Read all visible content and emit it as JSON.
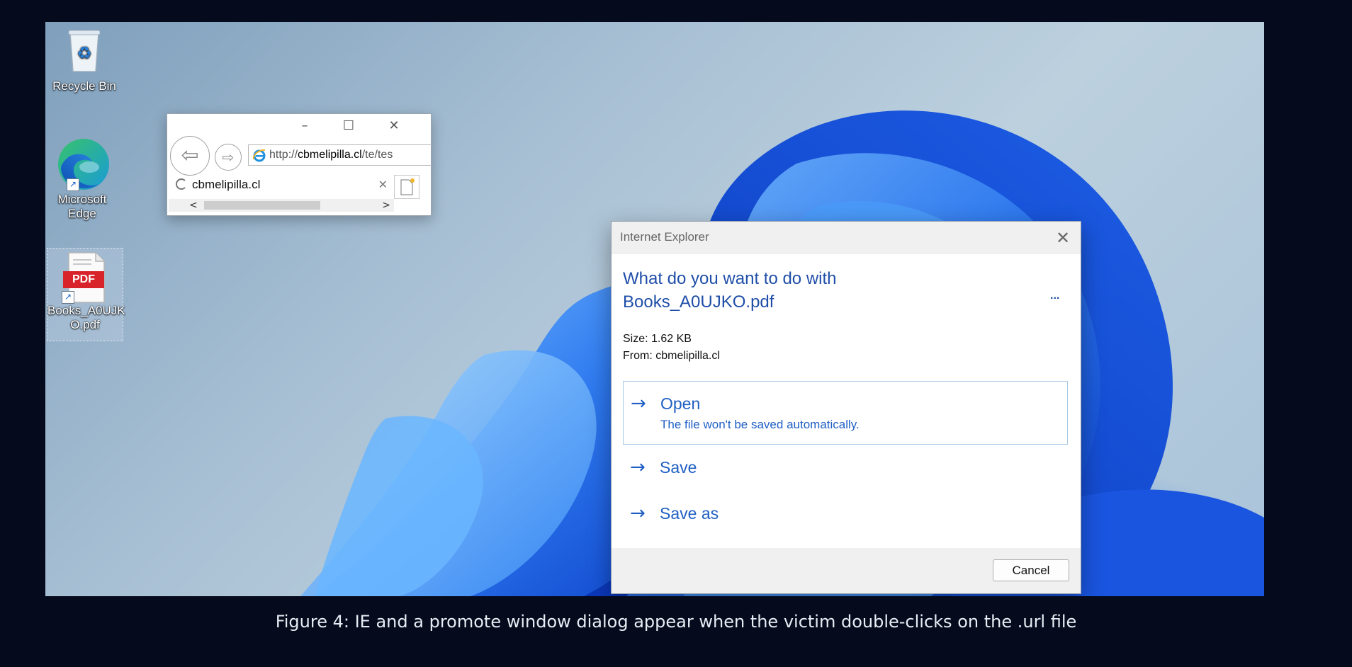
{
  "desktop": {
    "icons": [
      {
        "name": "recycle-bin",
        "label": "Recycle Bin"
      },
      {
        "name": "microsoft-edge",
        "label_lines": [
          "Microsoft",
          "Edge"
        ]
      },
      {
        "name": "pdf-shortcut",
        "label_lines": [
          "Books_A0UJK",
          "O.pdf"
        ],
        "badge": "PDF"
      }
    ]
  },
  "ie_window": {
    "address_prefix": "http://",
    "address_domain": "cbmelipilla.cl",
    "address_suffix": "/te/tes",
    "tab_title": "cbmelipilla.cl",
    "controls": {
      "minimize": "–",
      "maximize": "☐",
      "close": "✕"
    }
  },
  "dialog": {
    "title": "Internet Explorer",
    "question_line1": "What do you want to do with",
    "question_line2": "Books_A0UJKO.pdf",
    "more": "...",
    "size": "Size: 1.62 KB",
    "from": "From: cbmelipilla.cl",
    "options": [
      {
        "label": "Open",
        "description": "The file won't be saved automatically."
      },
      {
        "label": "Save"
      },
      {
        "label": "Save as"
      }
    ],
    "cancel": "Cancel"
  },
  "caption": "Figure 4: IE and a promote window dialog appear when the victim double-clicks on the .url file",
  "colors": {
    "page_bg": "#050a1c",
    "dialog_accent": "#1f4ea8",
    "option_text": "#1f5fc4",
    "pdf_badge": "#d8232a"
  }
}
